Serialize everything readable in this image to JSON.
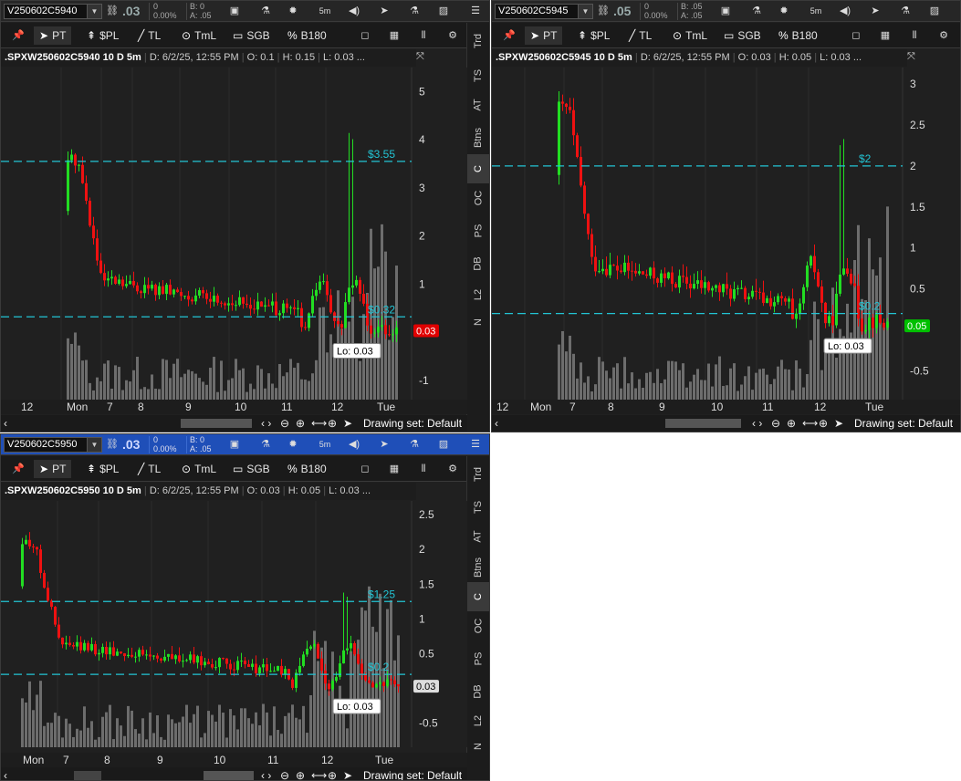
{
  "windows": [
    {
      "id": "w1",
      "symbol": "V250602C5940",
      "last_price": ".03",
      "change_line1": "0",
      "change_line2": "0.00%",
      "bid": "B: 0",
      "ask": "A: .05",
      "timeframe": "5m",
      "title": ".SPXW250602C5940 10 D 5m",
      "date": "D: 6/2/25, 12:55 PM",
      "open": "O: 0.1",
      "high": "H: 0.15",
      "low": "L: 0.03",
      "more": "...",
      "y_ticks": [
        "5",
        "4",
        "3",
        "2",
        "1",
        "-1"
      ],
      "y_values": [
        5,
        4,
        3,
        2,
        1,
        -1
      ],
      "lines": [
        {
          "label": "$3.55",
          "value": 3.55
        },
        {
          "label": "$0.32",
          "value": 0.32
        }
      ],
      "current_label": "0.03",
      "current_value": 0.03,
      "current_color": "#e00000",
      "lo_label": "Lo: 0.03",
      "x_labels": [
        "12",
        "Mon",
        "7",
        "8",
        "9",
        "10",
        "11",
        "12",
        "Tue"
      ],
      "ymin": -1.4,
      "ymax": 5.5,
      "peak_value": 3.6,
      "peak2_value": 4.0,
      "end_value": 0.03
    },
    {
      "id": "w2",
      "symbol": "V250602C5945",
      "last_price": ".05",
      "change_line1": "0",
      "change_line2": "0.00%",
      "bid": "B: .05",
      "ask": "A: .05",
      "timeframe": "5m",
      "title": ".SPXW250602C5945 10 D 5m",
      "date": "D: 6/2/25, 12:55 PM",
      "open": "O: 0.03",
      "high": "H: 0.05",
      "low": "L: 0.03",
      "more": "...",
      "y_ticks": [
        "3",
        "2.5",
        "2",
        "1.5",
        "1",
        "0.5",
        "-0.5"
      ],
      "y_values": [
        3,
        2.5,
        2,
        1.5,
        1,
        0.5,
        -0.5
      ],
      "lines": [
        {
          "label": "$2",
          "value": 2.0
        },
        {
          "label": "$0.2",
          "value": 0.2
        }
      ],
      "current_label": "0.05",
      "current_value": 0.05,
      "current_color": "#00c000",
      "lo_label": "Lo: 0.03",
      "x_labels": [
        "12",
        "Mon",
        "7",
        "8",
        "9",
        "10",
        "11",
        "12",
        "Tue"
      ],
      "ymin": -0.85,
      "ymax": 3.2,
      "peak_value": 2.7,
      "peak2_value": 2.25,
      "end_value": 0.05
    },
    {
      "id": "w3",
      "symbol": "V250602C5950",
      "last_price": ".03",
      "change_line1": "0",
      "change_line2": "0.00%",
      "bid": "B: 0",
      "ask": "A: .05",
      "timeframe": "5m",
      "title": ".SPXW250602C5950 10 D 5m",
      "date": "D: 6/2/25, 12:55 PM",
      "open": "O: 0.03",
      "high": "H: 0.05",
      "low": "L: 0.03",
      "more": "...",
      "y_ticks": [
        "2.5",
        "2",
        "1.5",
        "1",
        "0.5",
        "-0.5"
      ],
      "y_values": [
        2.5,
        2,
        1.5,
        1,
        0.5,
        -0.5
      ],
      "lines": [
        {
          "label": "$1.25",
          "value": 1.25
        },
        {
          "label": "$0.2",
          "value": 0.2
        }
      ],
      "current_label": "0.03",
      "current_value": 0.03,
      "current_color": "#dddddd",
      "lo_label": "Lo: 0.03",
      "x_labels": [
        "Mon",
        "7",
        "8",
        "9",
        "10",
        "11",
        "12",
        "Tue"
      ],
      "ymin": -0.85,
      "ymax": 2.7,
      "peak_value": 2.1,
      "peak2_value": 1.3,
      "end_value": 0.03
    }
  ],
  "toolbar": {
    "pt": "PT",
    "pl": "$PL",
    "tl": "TL",
    "tml": "TmL",
    "sgb": "SGB",
    "b180": "B180"
  },
  "side_tabs": [
    "Trd",
    "TS",
    "AT",
    "Btns",
    "C",
    "OC",
    "PS",
    "DB",
    "L2",
    "N"
  ],
  "drawing_set": "Drawing set: Default",
  "colors": {
    "up": "#22dd22",
    "down": "#ee1111",
    "volume": "#6d6d6d",
    "line": "#22c4d4",
    "bg": "#202020"
  }
}
